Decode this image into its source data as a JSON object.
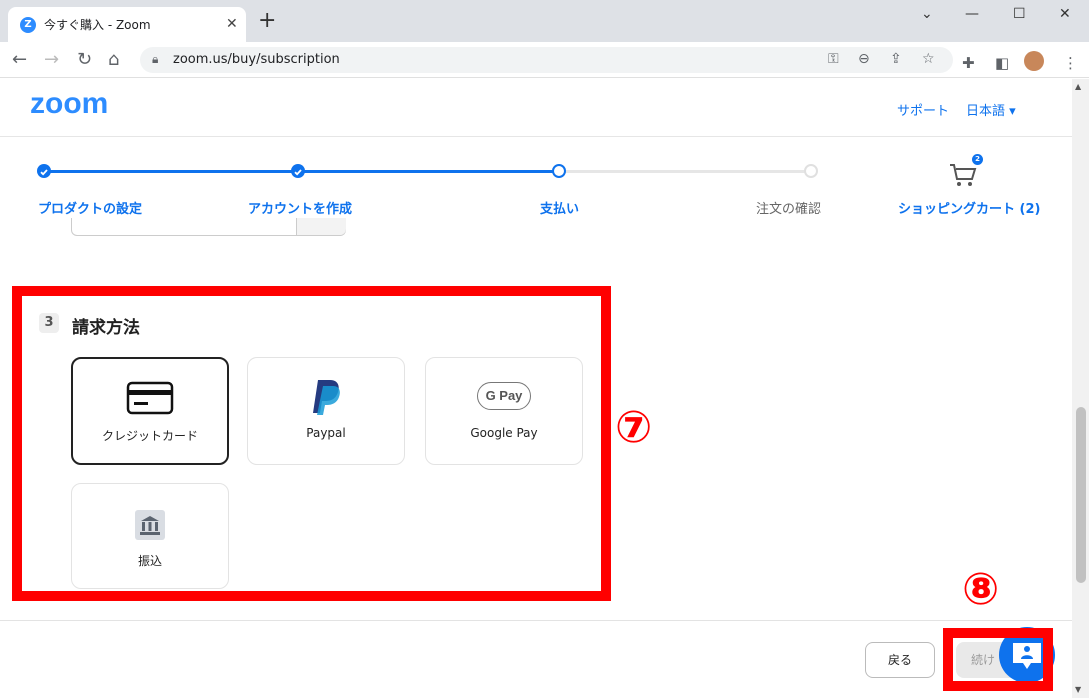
{
  "browser": {
    "tab_title": "今すぐ購入 - Zoom",
    "tab_favicon": "Z",
    "url": "zoom.us/buy/subscription",
    "new_tab": "+",
    "close": "✕",
    "minimize": "—",
    "maximize": "☐",
    "chevron": "⌄"
  },
  "header": {
    "logo": "zoom",
    "support": "サポート",
    "language": "日本語 ▾"
  },
  "stepper": {
    "steps": [
      {
        "label": "プロダクトの設定",
        "state": "done"
      },
      {
        "label": "アカウントを作成",
        "state": "done"
      },
      {
        "label": "支払い",
        "state": "current"
      },
      {
        "label": "注文の確認",
        "state": "pending"
      }
    ],
    "cart_label": "ショッピングカート (2)",
    "cart_count": "2"
  },
  "billing": {
    "section_number": "3",
    "section_title": "請求方法",
    "methods": [
      {
        "label": "クレジットカード",
        "icon": "credit-card-icon",
        "selected": true
      },
      {
        "label": "Paypal",
        "icon": "paypal-icon",
        "selected": false
      },
      {
        "label": "Google Pay",
        "icon": "google-pay-icon",
        "selected": false
      },
      {
        "label": "振込",
        "icon": "bank-icon",
        "selected": false
      }
    ],
    "gpay_badge": "G Pay"
  },
  "annotations": {
    "seven": "⑦",
    "eight": "⑧"
  },
  "footer": {
    "back_label": "戻る",
    "next_label": "続け"
  },
  "colors": {
    "accent": "#0e72ed",
    "highlight": "#ff0000"
  }
}
